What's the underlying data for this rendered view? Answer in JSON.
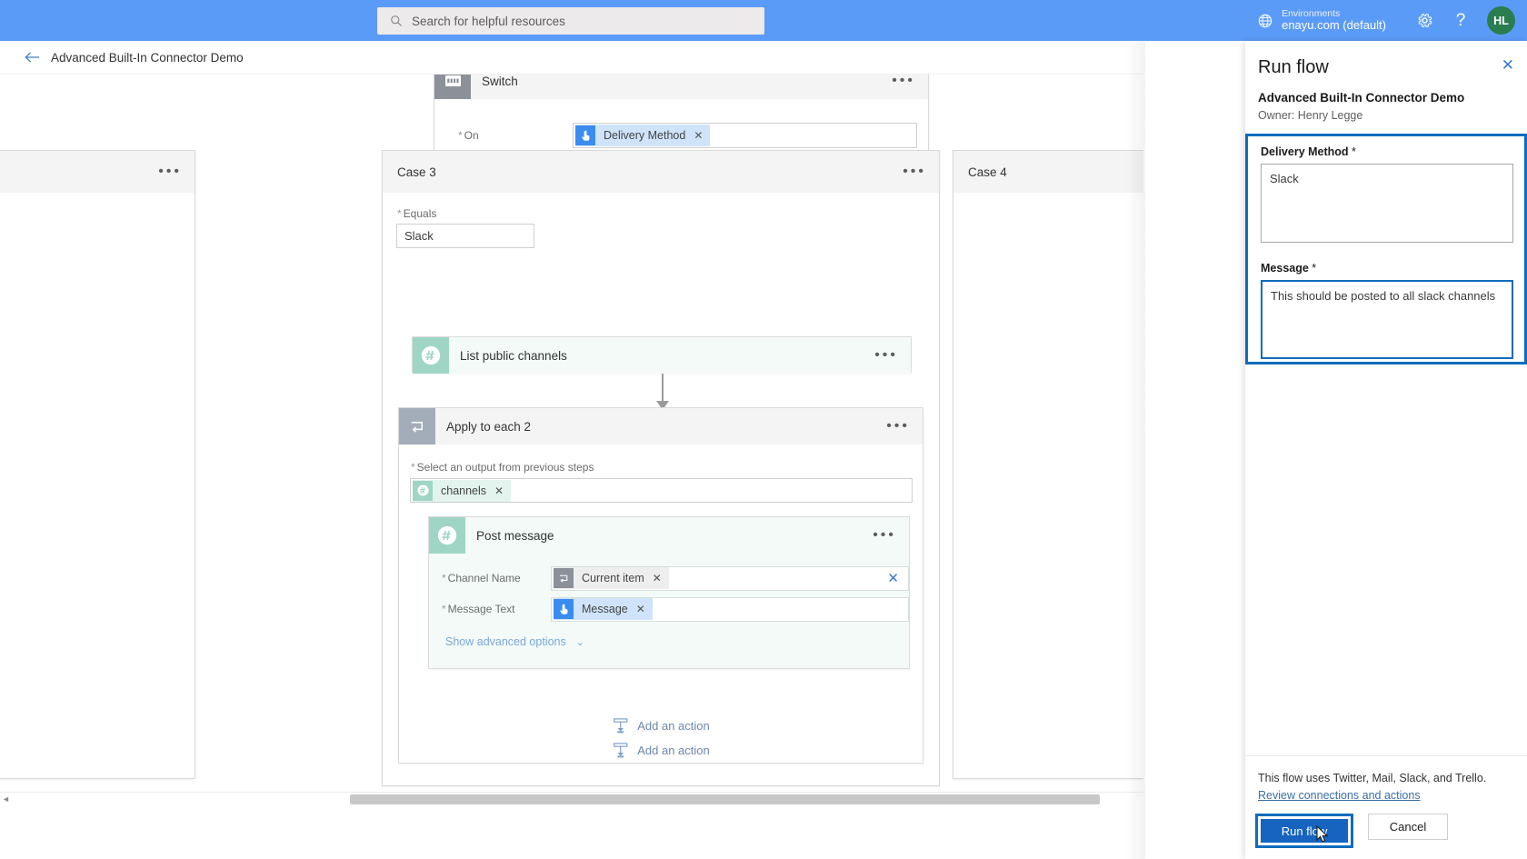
{
  "topbar": {
    "search_placeholder": "Search for helpful resources",
    "search_icon": "search-icon",
    "environments_label": "Environments",
    "environment_value": "enayu.com (default)",
    "environment_icon": "globe-icon",
    "settings_icon": "gear-icon",
    "help_icon": "question-mark-icon",
    "help_glyph": "?",
    "avatar_initials": "HL",
    "accent_blue": "#5b9bf8"
  },
  "commandbar": {
    "back_icon": "back-arrow-icon",
    "flow_name": "Advanced Built-In Connector Demo"
  },
  "canvas": {
    "switch_node": {
      "title": "Switch",
      "icon": "switch-icon",
      "more_icon": "ellipsis-icon",
      "on_label": "On",
      "on_required": "*",
      "on_token": "Delivery Method",
      "on_token_icon": "manual-trigger-icon"
    },
    "case_left": {
      "title": "",
      "more_icon": "ellipsis-icon"
    },
    "case_three": {
      "title": "Case 3",
      "more_icon": "ellipsis-icon",
      "equals_label": "Equals",
      "equals_required": "*",
      "equals_value": "Slack",
      "list_channels": {
        "title": "List public channels",
        "icon": "slack-icon",
        "more_icon": "ellipsis-icon"
      },
      "foreach": {
        "title": "Apply to each 2",
        "icon": "foreach-loop-icon",
        "more_icon": "ellipsis-icon",
        "select_label": "Select an output from previous steps",
        "select_required": "*",
        "select_token": "channels",
        "select_token_icon": "slack-icon",
        "post_message": {
          "title": "Post message",
          "icon": "slack-icon",
          "more_icon": "ellipsis-icon",
          "channel_label": "Channel Name",
          "channel_required": "*",
          "channel_token": "Current item",
          "channel_token_icon": "foreach-loop-icon",
          "clear_icon": "clear-x-icon",
          "message_label": "Message Text",
          "message_required": "*",
          "message_token": "Message",
          "message_token_icon": "manual-trigger-icon",
          "advanced_options": "Show advanced options",
          "advanced_chevron": "chevron-down-icon"
        },
        "add_action": "Add an action",
        "add_action_icon": "add-action-icon"
      },
      "add_action": "Add an action",
      "add_action_icon": "add-action-icon"
    },
    "case_right": {
      "title": "Case 4",
      "more_icon": "ellipsis-icon"
    },
    "scrollbar": {
      "icon": "horizontal-scrollbar",
      "left_arrow": "◄"
    }
  },
  "panel": {
    "title": "Run flow",
    "close_icon": "close-icon",
    "flow_name": "Advanced Built-In Connector Demo",
    "owner": "Owner: Henry Legge",
    "fields": [
      {
        "label": "Delivery Method",
        "required": "*",
        "value": "Slack"
      },
      {
        "label": "Message",
        "required": "*",
        "value": "This should be posted to all slack channels"
      }
    ],
    "footer_text": "This flow uses Twitter, Mail, Slack, and Trello.",
    "footer_link": "Review connections and actions",
    "primary_button": "Run flow",
    "secondary_button": "Cancel",
    "highlight_color": "#0f6cbd",
    "primary_button_color": "#1664c0"
  }
}
